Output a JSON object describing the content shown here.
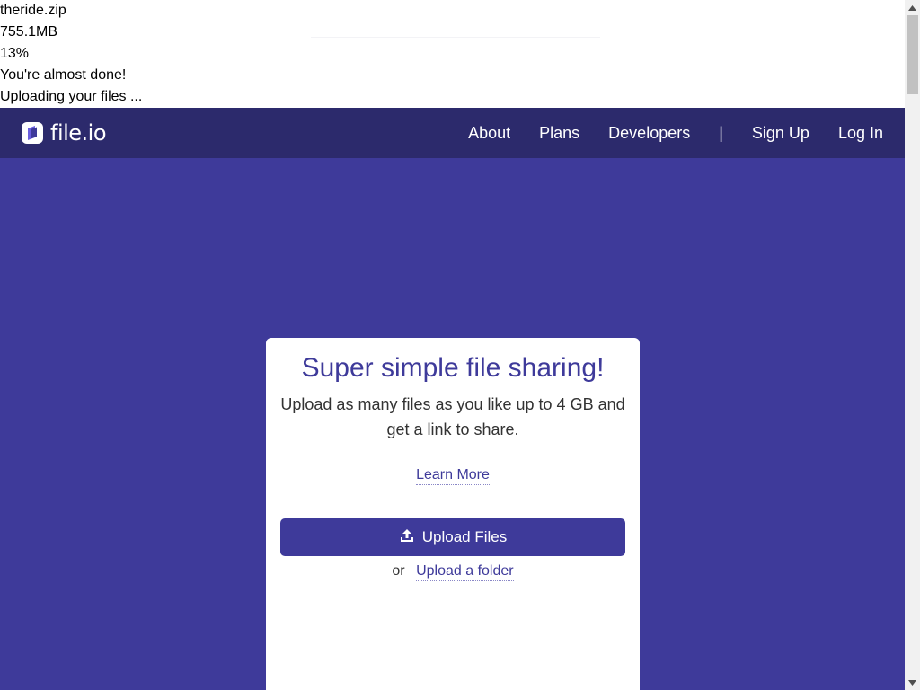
{
  "upload_status": {
    "file_name": "theride.zip",
    "file_size": "755.1MB",
    "progress_text": "13%",
    "progress": 0.13,
    "almost_done": "You're almost done!",
    "uploading": "Uploading your files ..."
  },
  "navbar": {
    "brand": "file.io",
    "links": {
      "about": "About",
      "plans": "Plans",
      "developers": "Developers",
      "separator": "|",
      "sign_up": "Sign Up",
      "log_in": "Log In"
    }
  },
  "card": {
    "title": "Super simple file sharing!",
    "description": "Upload as many files as you like up to 4 GB and get a link to share.",
    "learn_more": "Learn More",
    "upload_button": "Upload Files",
    "or_text": "or",
    "upload_folder": "Upload a folder"
  },
  "icons": {
    "logo": "file-io-logo-icon",
    "upload": "upload-icon",
    "scroll_up": "arrow-up-icon",
    "scroll_down": "arrow-down-icon"
  },
  "colors": {
    "nav_bg": "#2c2a6c",
    "hero_bg": "#3e3a9a",
    "accent": "#3e3a9a",
    "card_bg": "#ffffff"
  }
}
